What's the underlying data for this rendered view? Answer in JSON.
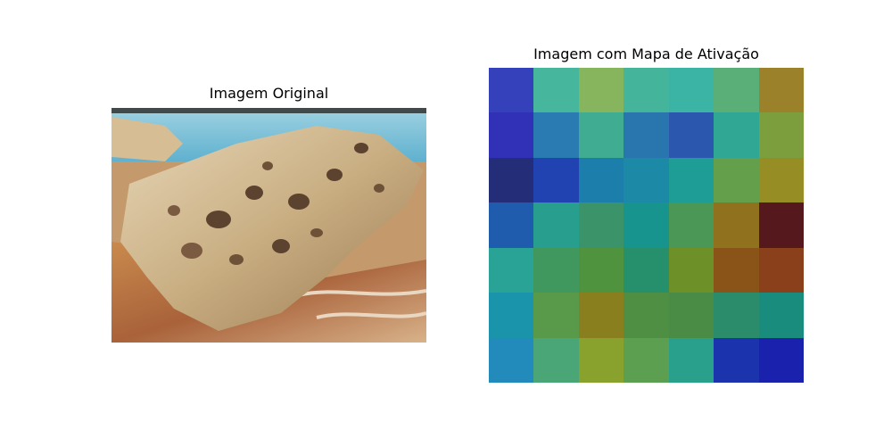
{
  "panels": {
    "left_title": "Imagem Original",
    "right_title": "Imagem com Mapa de Ativação"
  },
  "activation_grid": {
    "rows": 7,
    "cols": 7,
    "colors": [
      [
        "#3540bb",
        "#46b79d",
        "#87b55e",
        "#44b49a",
        "#3bb4a6",
        "#5aaf79",
        "#9c812b"
      ],
      [
        "#3131b7",
        "#2a7bb1",
        "#40ad93",
        "#2876ad",
        "#2b58ae",
        "#30a795",
        "#7c9e3c"
      ],
      [
        "#232d78",
        "#2142b1",
        "#1c7eaa",
        "#1c8aa7",
        "#1e9c96",
        "#649f4c",
        "#968d24"
      ],
      [
        "#205cad",
        "#289e8f",
        "#3b9469",
        "#18948f",
        "#4b9755",
        "#8f711e",
        "#55191d"
      ],
      [
        "#29a396",
        "#40985f",
        "#4f933f",
        "#268f6b",
        "#6e9028",
        "#8a5419",
        "#8a401b"
      ],
      [
        "#1994aa",
        "#589a4a",
        "#8a7f1f",
        "#4f8f43",
        "#4a8c45",
        "#2a8c6b",
        "#1a8c7e"
      ],
      [
        "#228bbb",
        "#4aa676",
        "#88a22d",
        "#5d9f50",
        "#29a08c",
        "#1b33ad",
        "#1a21ad"
      ]
    ]
  }
}
